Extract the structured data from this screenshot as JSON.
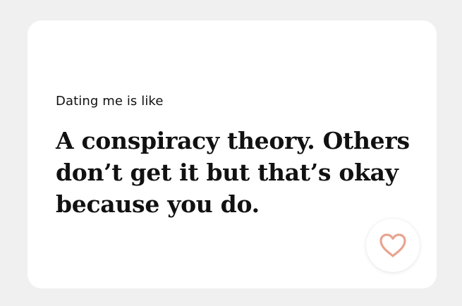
{
  "prompt": {
    "label": "Dating me is like",
    "answer": "A conspiracy theory. Others don’t get it but that’s okay because you do."
  },
  "like_button": {
    "icon": "heart-outline-icon",
    "color": "#e8a490"
  },
  "colors": {
    "background": "#f0f0f0",
    "card": "#ffffff",
    "text": "#111111"
  }
}
